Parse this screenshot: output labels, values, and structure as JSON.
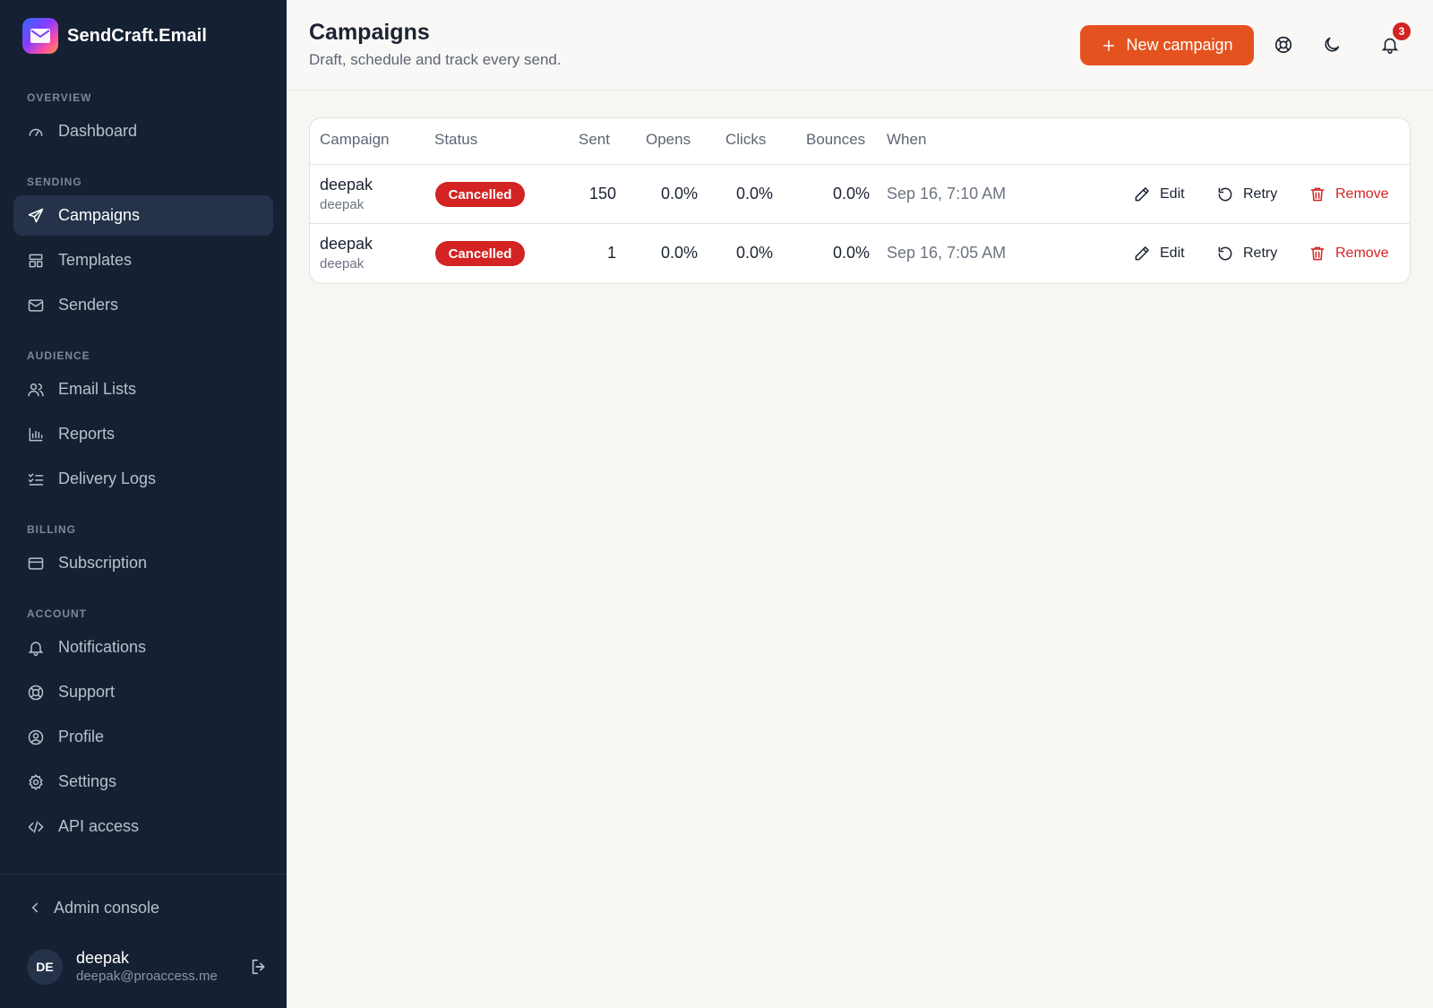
{
  "app": {
    "name": "SendCraft.Email"
  },
  "sidebar": {
    "sections": {
      "overview": "OVERVIEW",
      "sending": "SENDING",
      "audience": "AUDIENCE",
      "billing": "BILLING",
      "account": "ACCOUNT"
    },
    "items": {
      "dashboard": "Dashboard",
      "campaigns": "Campaigns",
      "templates": "Templates",
      "senders": "Senders",
      "email_lists": "Email Lists",
      "reports": "Reports",
      "delivery_logs": "Delivery Logs",
      "subscription": "Subscription",
      "notifications": "Notifications",
      "support": "Support",
      "profile": "Profile",
      "settings": "Settings",
      "api_access": "API access"
    },
    "active": "campaigns",
    "admin_console": "Admin console",
    "user": {
      "initials": "DE",
      "name": "deepak",
      "email": "deepak@proaccess.me"
    }
  },
  "header": {
    "title": "Campaigns",
    "subtitle": "Draft, schedule and track every send.",
    "new_campaign_label": "New campaign",
    "notification_count": "3"
  },
  "table": {
    "columns": {
      "campaign": "Campaign",
      "status": "Status",
      "sent": "Sent",
      "opens": "Opens",
      "clicks": "Clicks",
      "bounces": "Bounces",
      "when": "When"
    },
    "actions": {
      "edit": "Edit",
      "retry": "Retry",
      "remove": "Remove"
    },
    "rows": [
      {
        "name": "deepak",
        "subject": "deepak",
        "status": "Cancelled",
        "sent": "150",
        "opens": "0.0%",
        "clicks": "0.0%",
        "bounces": "0.0%",
        "when": "Sep 16, 7:10 AM"
      },
      {
        "name": "deepak",
        "subject": "deepak",
        "status": "Cancelled",
        "sent": "1",
        "opens": "0.0%",
        "clicks": "0.0%",
        "bounces": "0.0%",
        "when": "Sep 16, 7:05 AM"
      }
    ]
  },
  "colors": {
    "sidebar_bg": "#162033",
    "accent": "#e4531f",
    "danger": "#d32323",
    "page_bg": "#f7f6f3"
  },
  "icons": {
    "dashboard": "gauge-icon",
    "campaigns": "send-icon",
    "templates": "layout-icon",
    "senders": "mail-icon",
    "email_lists": "users-icon",
    "reports": "bar-chart-icon",
    "delivery_logs": "list-checks-icon",
    "subscription": "credit-card-icon",
    "notifications": "bell-icon",
    "support": "lifebuoy-icon",
    "profile": "user-circle-icon",
    "settings": "gear-icon",
    "api_access": "code-icon"
  }
}
